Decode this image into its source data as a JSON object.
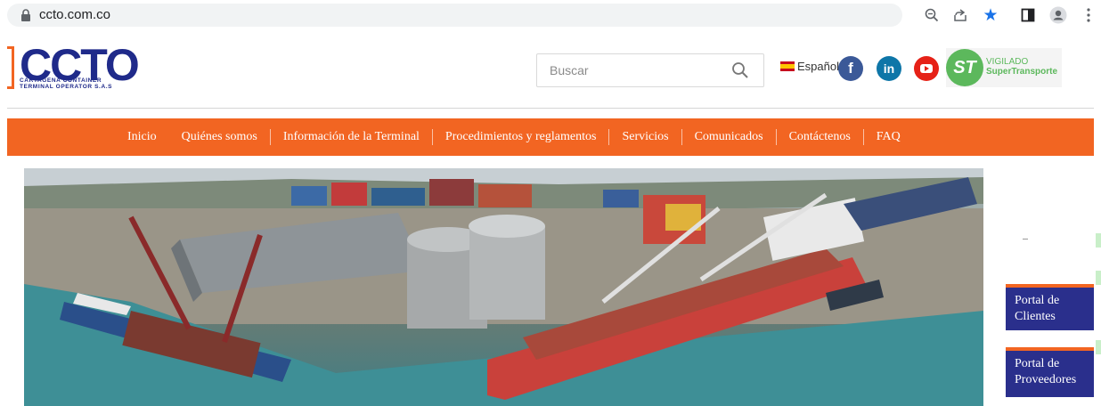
{
  "browser": {
    "url": "ccto.com.co",
    "icons": [
      "lock-icon",
      "zoom-icon",
      "share-icon",
      "bookmark-star-icon",
      "side-panel-icon",
      "profile-icon",
      "menu-dots-icon"
    ],
    "star_color": "#1a73e8"
  },
  "header": {
    "logo_text": "CCTO",
    "logo_subtitle_line1": "CARTAGENA CONTAINER",
    "logo_subtitle_line2": "TERMINAL OPERATOR S.A.S",
    "search_placeholder": "Buscar",
    "language": "Español",
    "social": [
      "facebook-icon",
      "linkedin-icon",
      "youtube-icon"
    ],
    "vigilado_line1": "VIGILADO",
    "vigilado_line2": "SuperTransporte",
    "vigilado_badge": "ST"
  },
  "nav": {
    "items": [
      "Inicio",
      "Quiénes somos",
      "Información de la Terminal",
      "Procedimientos y reglamentos",
      "Servicios",
      "Comunicados",
      "Contáctenos",
      "FAQ"
    ]
  },
  "portals": {
    "clientes": "Portal de Clientes",
    "proveedores": "Portal de Proveedores"
  },
  "colors": {
    "brand_blue": "#1f2a8a",
    "brand_orange": "#f26522",
    "portal_blue": "#2a2f8c"
  }
}
